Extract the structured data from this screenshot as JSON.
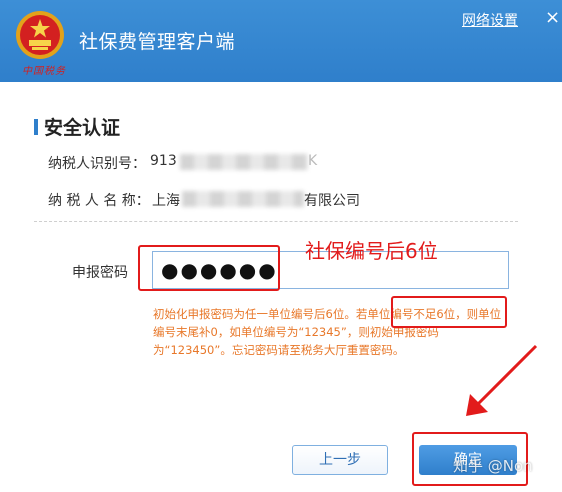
{
  "header": {
    "logo_text": "中国税务",
    "app_title": "社保费管理客户端",
    "network_settings": "网络设置",
    "close": "×"
  },
  "section": {
    "title": "安全认证"
  },
  "info": {
    "tax_id_label": "纳税人识别号：",
    "tax_id_visible_prefix": "913",
    "tax_id_visible_suffix": "K",
    "name_label": "纳 税 人 名 称：",
    "name_visible_prefix": "上海",
    "name_visible_suffix": "有限公司"
  },
  "form": {
    "password_label": "申报密码",
    "password_value": "●●●●●●",
    "hint": "初始化申报密码为任一单位编号后6位。若单位编号不足6位，则单位编号末尾补0，如单位编号为“12345”，则初始申报密码为“123450”。忘记密码请至税务大厅重置密码。"
  },
  "annotation": {
    "text": "社保编号后6位",
    "color": "#e21b1b"
  },
  "buttons": {
    "back": "上一步",
    "confirm": "确定"
  },
  "watermark": "知乎 @Non",
  "colors": {
    "header_blue": "#2f7fcb",
    "hint_orange": "#e8782a",
    "annotation_red": "#e21b1b"
  }
}
